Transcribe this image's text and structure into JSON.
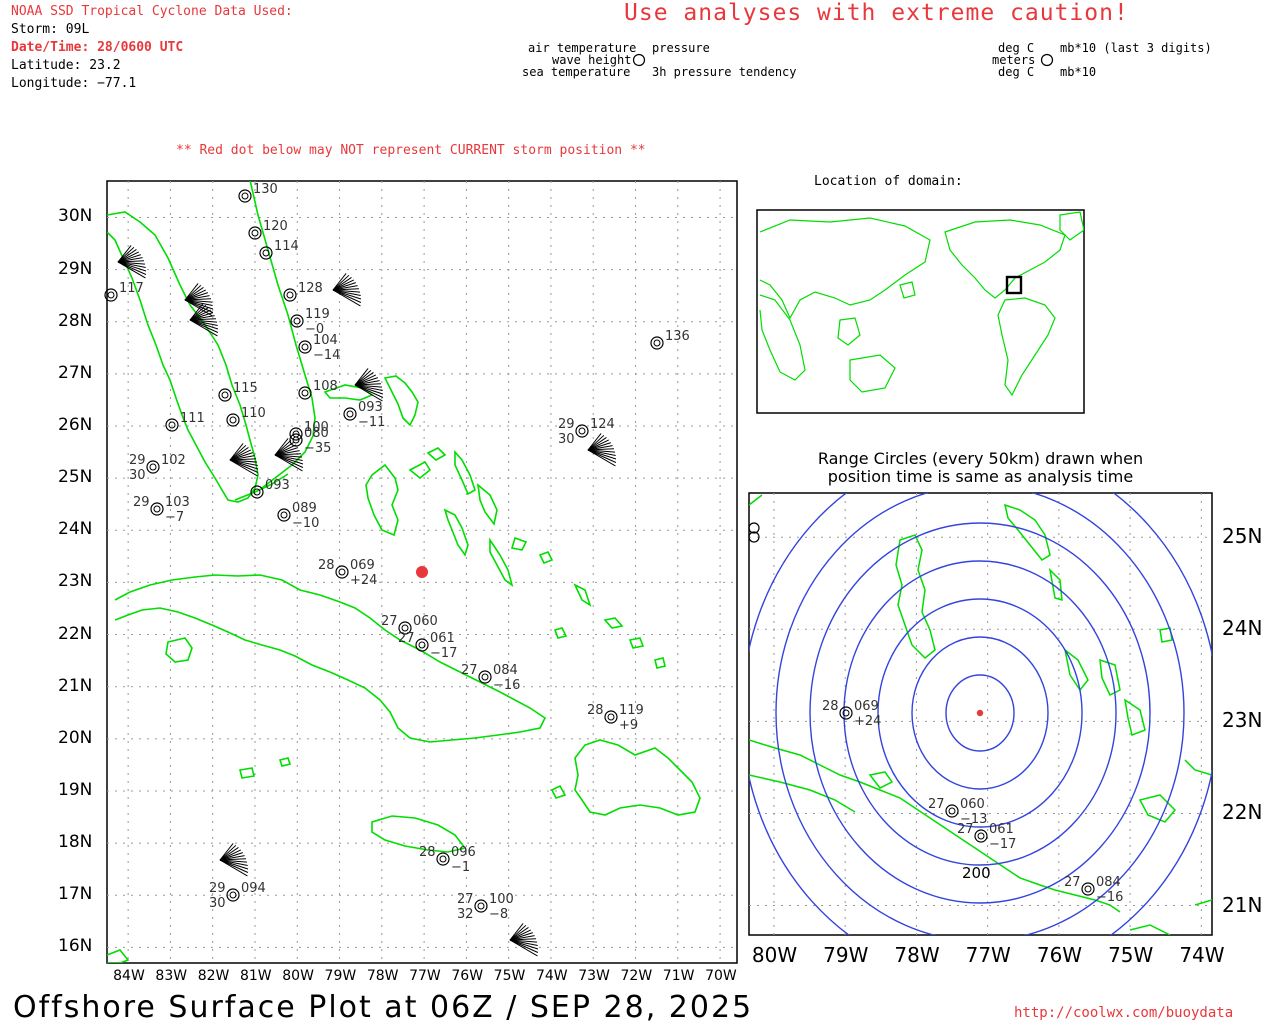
{
  "header": {
    "source_title": "NOAA SSD Tropical Cyclone Data Used:",
    "storm": "Storm: 09L",
    "datetime": "Date/Time: 28/0600 UTC",
    "latitude": "Latitude: 23.2",
    "longitude": "Longitude: −77.1",
    "caution": "Use analyses with extreme caution!",
    "red_dot_note": "** Red dot below may NOT represent CURRENT storm position **"
  },
  "legend": {
    "left": {
      "air_temperature": "air temperature",
      "wave_height": "wave height",
      "sea_temperature": "sea temperature",
      "pressure": "pressure",
      "pressure_tendency": "3h pressure tendency"
    },
    "right": {
      "deg_c_top": "deg C",
      "meters": "meters",
      "deg_c_bottom": "deg C",
      "mb_last3": "mb*10 (last 3 digits)",
      "mb10": "mb*10"
    }
  },
  "main_map": {
    "lat_labels": [
      "30N",
      "29N",
      "28N",
      "27N",
      "26N",
      "25N",
      "24N",
      "23N",
      "22N",
      "21N",
      "20N",
      "19N",
      "18N",
      "17N",
      "16N"
    ],
    "lon_labels": [
      "84W",
      "83W",
      "82W",
      "81W",
      "80W",
      "79W",
      "78W",
      "77W",
      "76W",
      "75W",
      "74W",
      "73W",
      "72W",
      "71W",
      "70W"
    ],
    "storm_position": {
      "lat": 23.2,
      "lon": -77.1
    },
    "stations": [
      {
        "t": "28",
        "p": "069",
        "d": "+24"
      },
      {
        "t": "27",
        "p": "060",
        "d": ""
      },
      {
        "t": "27",
        "p": "061",
        "d": "−17"
      },
      {
        "t": "27",
        "p": "084",
        "d": "−16"
      },
      {
        "t": "28",
        "p": "119",
        "d": "+9"
      },
      {
        "t": "28",
        "p": "096",
        "d": "−1"
      },
      {
        "t": "27",
        "p": "100",
        "d": "−8",
        "s": "32"
      },
      {
        "t": "29",
        "p": "124",
        "d": "",
        "s": "30"
      },
      {
        "t": "",
        "p": "136",
        "d": ""
      },
      {
        "t": "29",
        "p": "094",
        "d": "",
        "s": "30"
      },
      {
        "t": "29",
        "p": "103",
        "d": "−7"
      },
      {
        "t": "29",
        "p": "102",
        "d": "",
        "s": "30"
      },
      {
        "t": "",
        "p": "130",
        "d": ""
      },
      {
        "t": "",
        "p": "117",
        "d": ""
      },
      {
        "t": "",
        "p": "115",
        "d": ""
      },
      {
        "t": "",
        "p": "110",
        "d": ""
      },
      {
        "t": "",
        "p": "111",
        "d": ""
      },
      {
        "t": "",
        "p": "114",
        "d": ""
      },
      {
        "t": "",
        "p": "120",
        "d": ""
      },
      {
        "t": "",
        "p": "119",
        "d": "−0"
      },
      {
        "t": "",
        "p": "104",
        "d": "−14"
      },
      {
        "t": "",
        "p": "108",
        "d": ""
      },
      {
        "t": "",
        "p": "093",
        "d": "−11"
      },
      {
        "t": "",
        "p": "080",
        "d": "−35"
      },
      {
        "t": "",
        "p": "089",
        "d": "−10"
      },
      {
        "t": "",
        "p": "093",
        "d": ""
      },
      {
        "t": "",
        "p": "100",
        "d": ""
      },
      {
        "t": "",
        "p": "128",
        "d": ""
      }
    ]
  },
  "inset_location": {
    "title": "Location of domain:"
  },
  "range_circles": {
    "title_line1": "Range Circles (every 50km) drawn when",
    "title_line2": "position time is same as analysis time",
    "lat_labels": [
      "25N",
      "24N",
      "23N",
      "22N",
      "21N"
    ],
    "lon_labels": [
      "80W",
      "79W",
      "78W",
      "77W",
      "76W",
      "75W",
      "74W"
    ],
    "radius_label": "200",
    "stations": [
      {
        "t": "28",
        "p": "069",
        "d": "+24"
      },
      {
        "t": "27",
        "p": "060",
        "d": "−13"
      },
      {
        "t": "27",
        "p": "061",
        "d": "−17"
      },
      {
        "t": "27",
        "p": "084",
        "d": "−16"
      }
    ]
  },
  "footer": {
    "title": "Offshore Surface Plot at 06Z / SEP 28, 2025",
    "url": "http://coolwx.com/buoydata"
  },
  "colors": {
    "land": "#00dd00",
    "range_circle": "#3344dd",
    "accent_red": "#e8383b",
    "grid": "#999999"
  }
}
